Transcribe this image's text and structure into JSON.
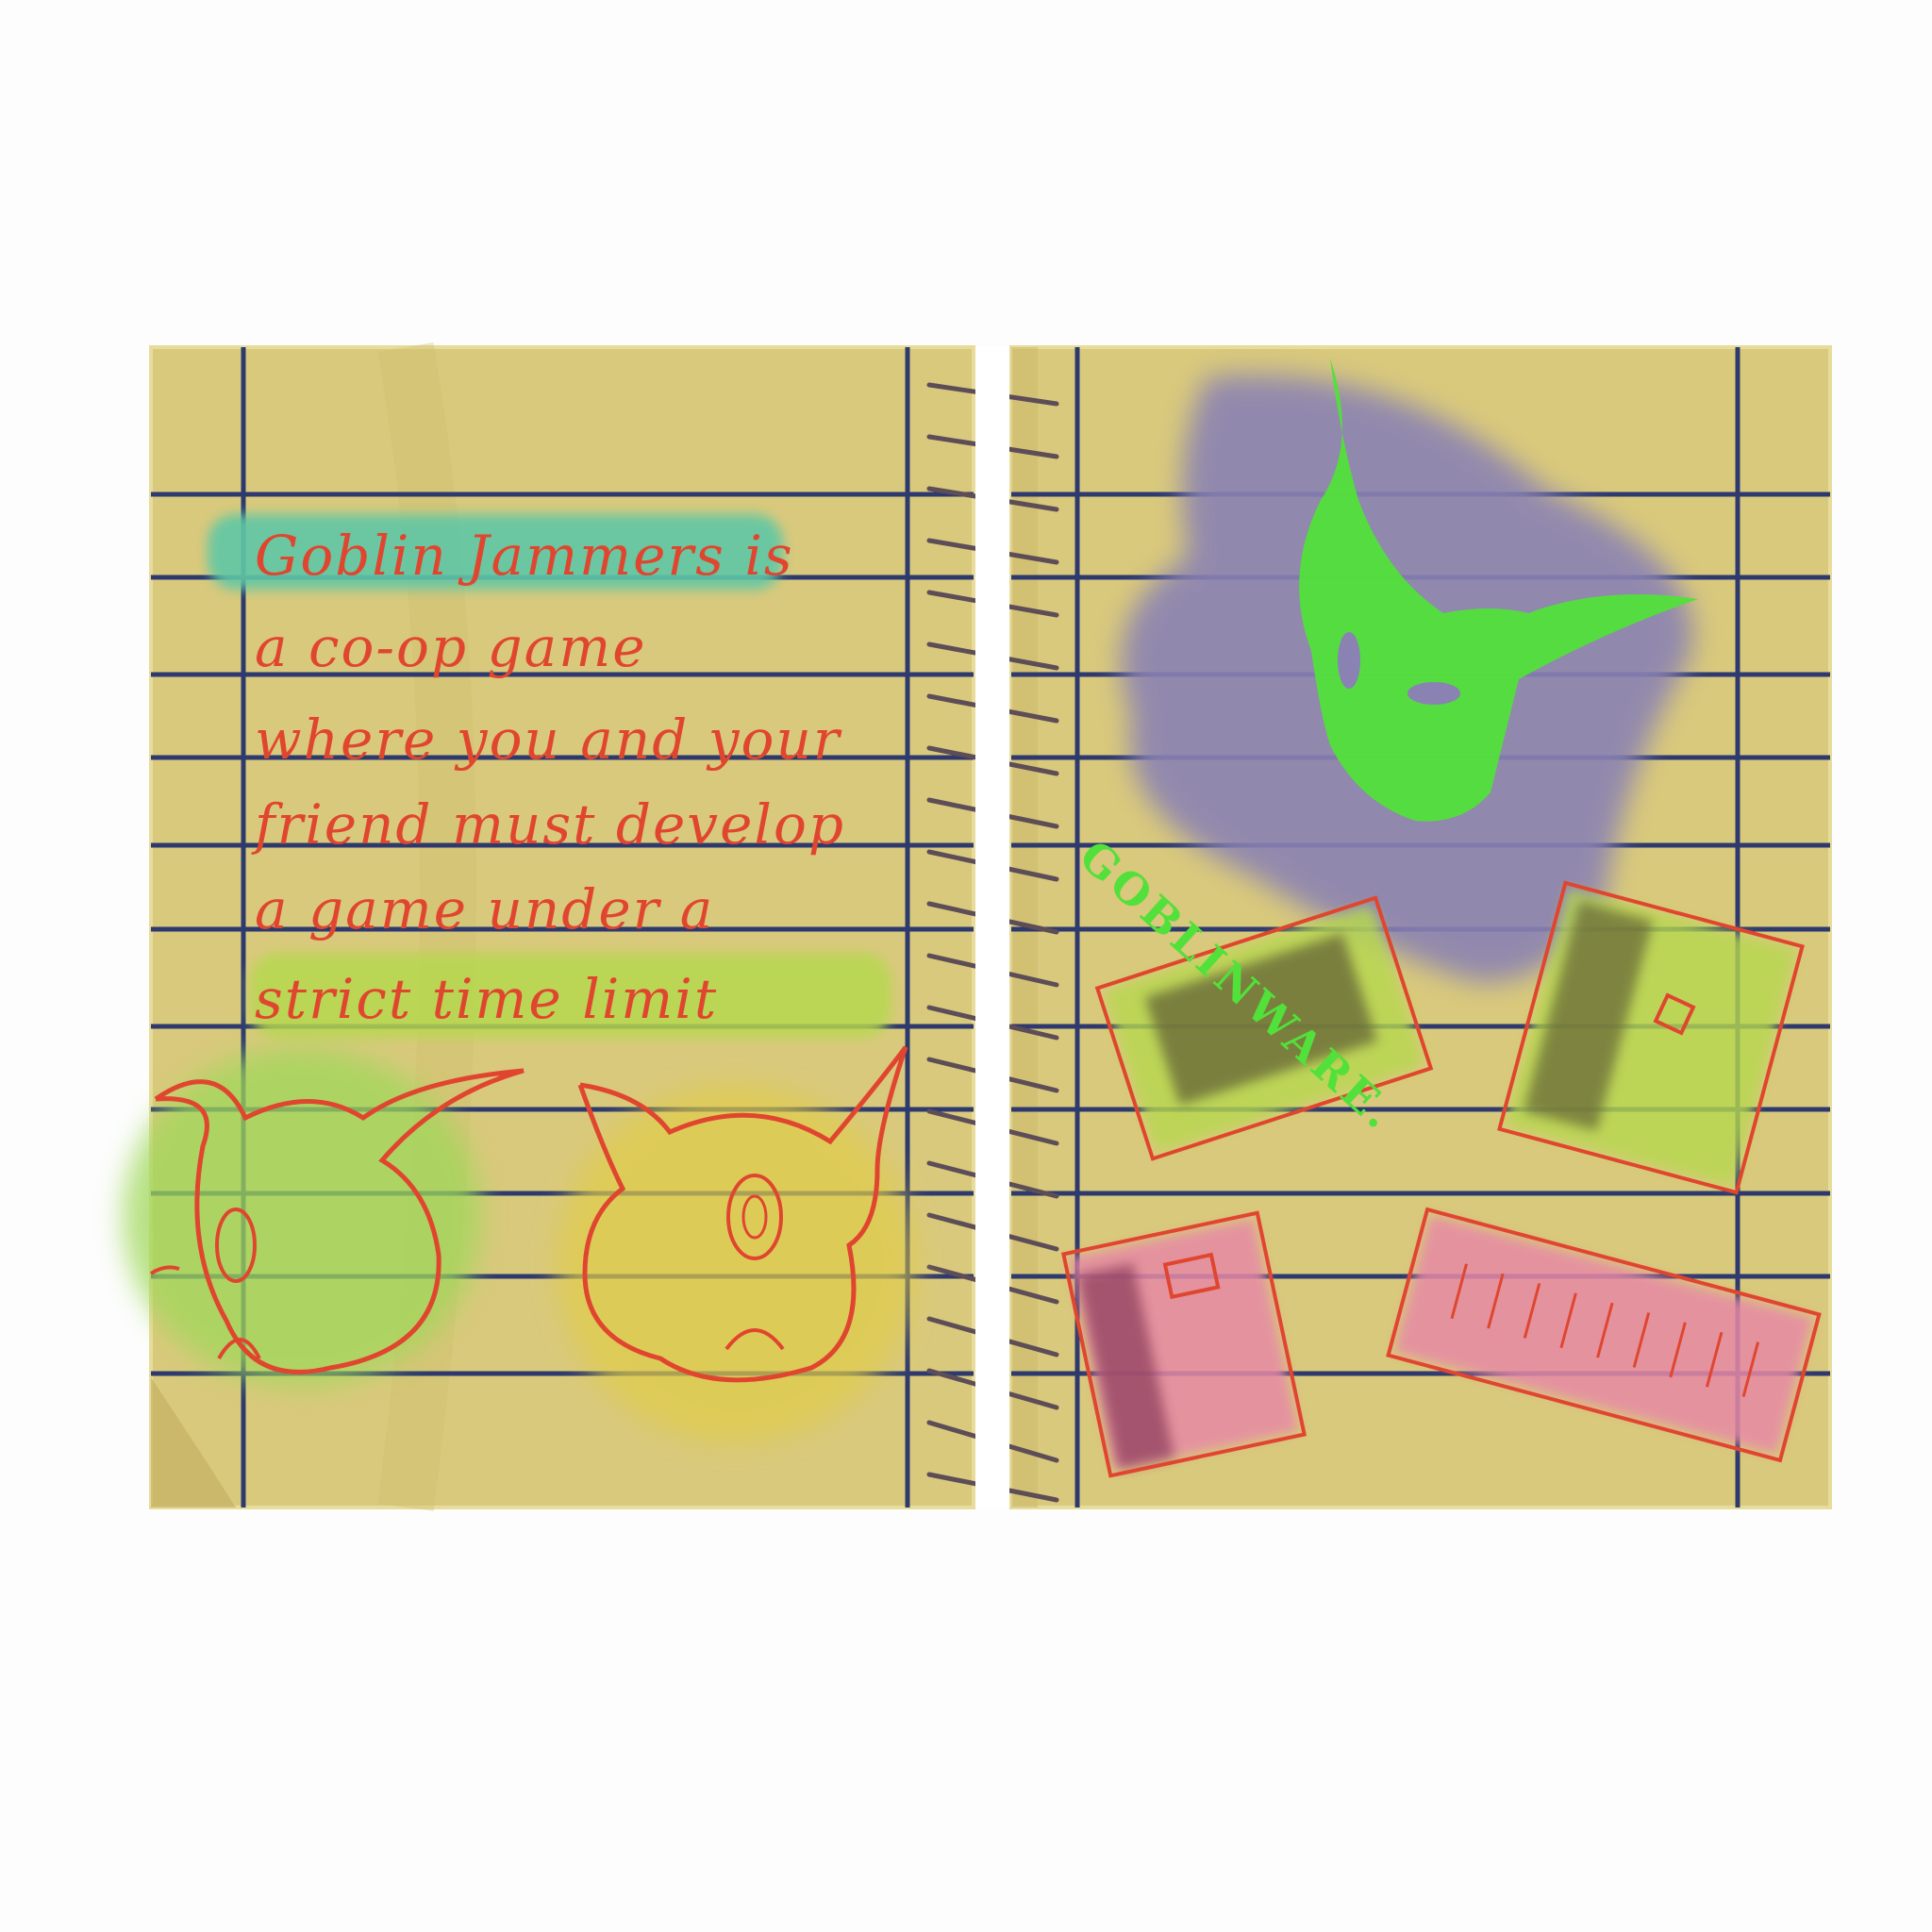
{
  "notebook": {
    "text_lines": [
      "Goblin Jammers is",
      "a co-op game",
      "where you and your",
      "friend must develop",
      "a game under a",
      "strict time limit"
    ],
    "logo_text": "GOBLINWARE.",
    "colors": {
      "paper": "#d9c97c",
      "rule": "#2e3a6e",
      "ink": "#e0462f",
      "spiral": "#5d4d57",
      "logo_green": "#52e03a",
      "logo_smudge": "#8a82b3",
      "teal_highlight": "#5ec7a6",
      "lime_highlight": "#b6d84f",
      "pink": "#e689a5"
    }
  }
}
